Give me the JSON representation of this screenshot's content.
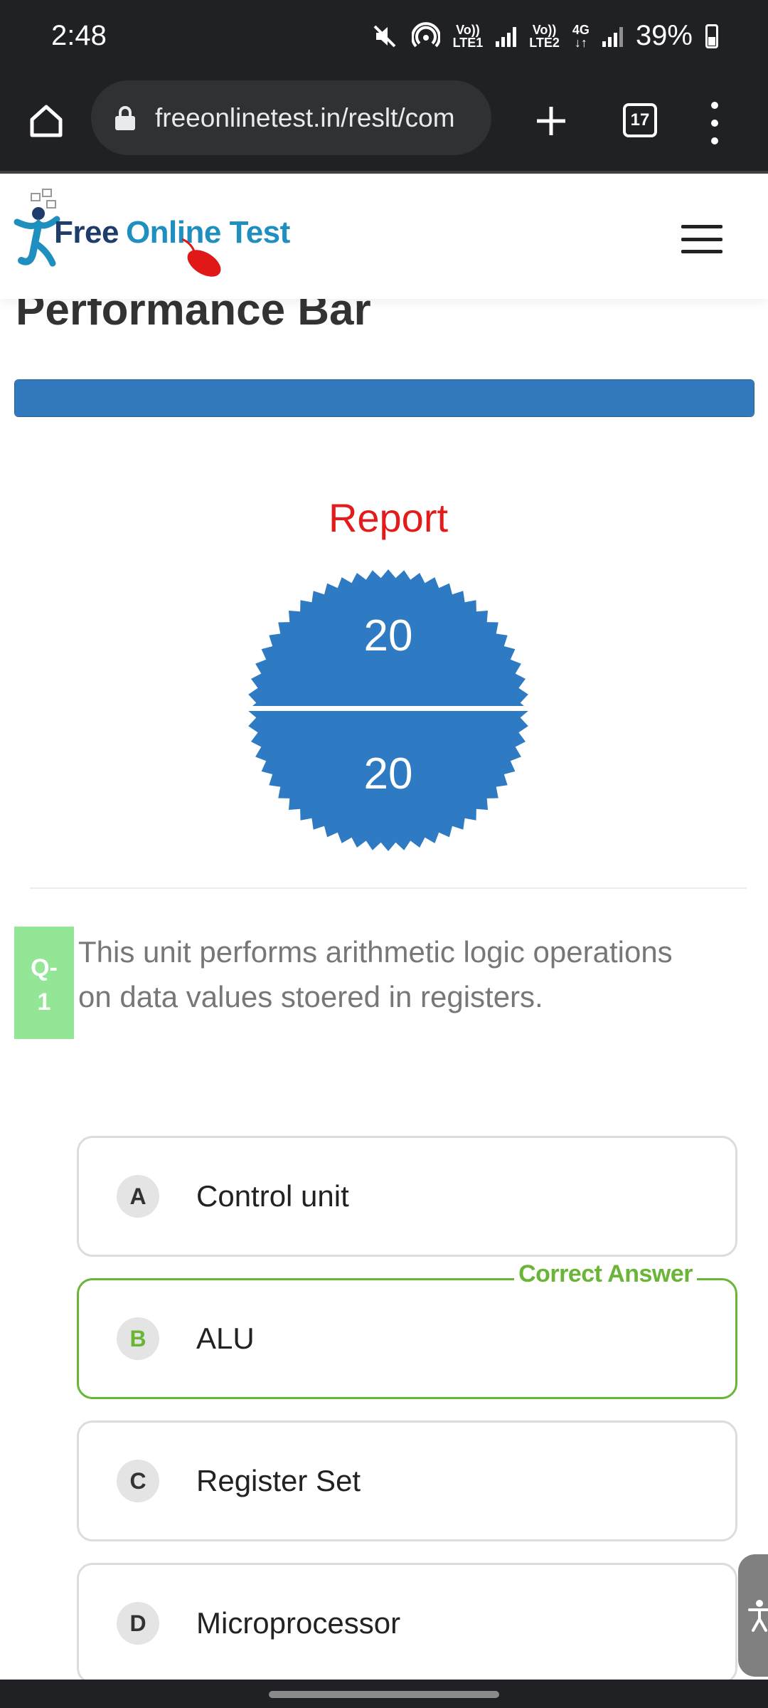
{
  "status_bar": {
    "time": "2:48",
    "volte1": "Vo))\nLTE1",
    "volte2": "Vo))\nLTE2",
    "network": "4G\n↓↑",
    "battery": "39%"
  },
  "browser": {
    "url": "freeonlinetest.in/reslt/com",
    "tab_count": "17"
  },
  "site": {
    "logo_word1": "Free",
    "logo_word2": "Online Test"
  },
  "performance": {
    "title": "Performance Bar",
    "progress_fraction": 1.0,
    "bar_color": "#3278bc"
  },
  "report": {
    "title": "Report",
    "score": "20",
    "total": "20",
    "badge_color": "#2f7bc3"
  },
  "question": {
    "number_label": "Q-\n1",
    "text": "This unit performs arithmetic logic operations on data values stoered in registers.",
    "correct_label": "Correct Answer",
    "options": [
      {
        "letter": "A",
        "text": "Control unit"
      },
      {
        "letter": "B",
        "text": "ALU"
      },
      {
        "letter": "C",
        "text": "Register Set"
      },
      {
        "letter": "D",
        "text": "Microprocessor"
      }
    ]
  },
  "colors": {
    "correct": "#6ab536",
    "question_badge": "#93e695",
    "report_title": "#e41b1b"
  }
}
